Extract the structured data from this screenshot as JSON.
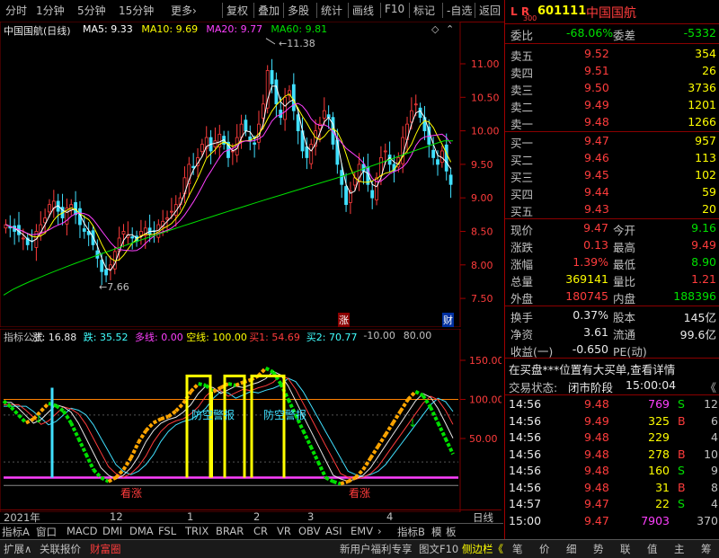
{
  "toolbar": {
    "period_items": [
      "分时",
      "1分钟",
      "5分钟",
      "15分钟",
      "更多›"
    ],
    "action_items": [
      "复权",
      "叠加",
      "多股",
      "统计",
      "画线",
      "F10",
      "标记",
      "-自选",
      "返回"
    ]
  },
  "main_chart": {
    "title": "中国国航(日线)",
    "ma_labels": [
      {
        "text": "MA5: 9.33",
        "color": "#ffffff"
      },
      {
        "text": "MA10: 9.69",
        "color": "#ffff00"
      },
      {
        "text": "MA20: 9.77",
        "color": "#ff40ff"
      },
      {
        "text": "MA60: 9.81",
        "color": "#00e000"
      }
    ],
    "price_axis": [
      "11.00",
      "10.50",
      "10.00",
      "9.50",
      "9.00",
      "8.50",
      "8.00",
      "7.50"
    ],
    "high_label": "11.38",
    "low_label": "7.66",
    "badge_zhang": "涨",
    "badge_cai": "财"
  },
  "indicator": {
    "header": [
      {
        "text": "指标公式",
        "color": "#c0c0c0"
      },
      {
        "text": "涨: 16.88",
        "color": "#e8e8e8"
      },
      {
        "text": "跌: 35.52",
        "color": "#40ffff"
      },
      {
        "text": "多线: 0.00",
        "color": "#ff40ff"
      },
      {
        "text": "空线: 100.00",
        "color": "#ffff00"
      },
      {
        "text": "买1: 54.69",
        "color": "#ff3c3c"
      },
      {
        "text": "买2: 70.77",
        "color": "#40ffff"
      },
      {
        "text": "-10.00",
        "color": "#c0c0c0"
      },
      {
        "text": "80.00",
        "color": "#c0c0c0"
      }
    ],
    "axis": [
      "150.00",
      "100.00",
      "50.00"
    ],
    "annotations": {
      "fangkong": "防空警报",
      "kanzhang_left": "看涨",
      "kanzhang_right": "看涨"
    }
  },
  "date_axis": {
    "labels": [
      "2021年",
      "12",
      "1",
      "2",
      "3",
      "4"
    ],
    "right_label": "日线"
  },
  "tabs": {
    "items": [
      "指标A",
      "窗口",
      "MACD",
      "DMI",
      "DMA",
      "FSL",
      "TRIX",
      "BRAR",
      "CR",
      "VR",
      "OBV",
      "ASI",
      "EMV",
      "›",
      "指标B",
      "模",
      "板"
    ]
  },
  "bottom_bar": {
    "left": [
      "扩展∧",
      "关联报价",
      "财富圈"
    ],
    "middle": [
      "新用户福利专享",
      "图文F10",
      "侧边栏《"
    ],
    "right": [
      "笔",
      "价",
      "细",
      "势",
      "联",
      "值",
      "主",
      "筹"
    ]
  },
  "quote": {
    "code": "601111",
    "name": "中国国航",
    "l_r_label": "L R",
    "market_label": "300",
    "weibi_label": "委比",
    "weibi_value": "-68.06%",
    "weicha_label": "委差",
    "weicha_value": "-5332",
    "sells": [
      {
        "label": "卖五",
        "price": "9.52",
        "vol": "354"
      },
      {
        "label": "卖四",
        "price": "9.51",
        "vol": "26"
      },
      {
        "label": "卖三",
        "price": "9.50",
        "vol": "3736"
      },
      {
        "label": "卖二",
        "price": "9.49",
        "vol": "1201"
      },
      {
        "label": "卖一",
        "price": "9.48",
        "vol": "1266"
      }
    ],
    "buys": [
      {
        "label": "买一",
        "price": "9.47",
        "vol": "957"
      },
      {
        "label": "买二",
        "price": "9.46",
        "vol": "113"
      },
      {
        "label": "买三",
        "price": "9.45",
        "vol": "102"
      },
      {
        "label": "买四",
        "price": "9.44",
        "vol": "59"
      },
      {
        "label": "买五",
        "price": "9.43",
        "vol": "20"
      }
    ],
    "stats": [
      {
        "l1": "现价",
        "v1": "9.47",
        "c1": "#ff3c3c",
        "l2": "今开",
        "v2": "9.16",
        "c2": "#00e000"
      },
      {
        "l1": "涨跌",
        "v1": "0.13",
        "c1": "#ff3c3c",
        "l2": "最高",
        "v2": "9.49",
        "c2": "#ff3c3c"
      },
      {
        "l1": "涨幅",
        "v1": "1.39%",
        "c1": "#ff3c3c",
        "l2": "最低",
        "v2": "8.90",
        "c2": "#00e000"
      },
      {
        "l1": "总量",
        "v1": "369141",
        "c1": "#ffff00",
        "l2": "量比",
        "v2": "1.21",
        "c2": "#ff3c3c"
      },
      {
        "l1": "外盘",
        "v1": "180745",
        "c1": "#ff3c3c",
        "l2": "内盘",
        "v2": "188396",
        "c2": "#00e000"
      }
    ],
    "stats2": [
      {
        "l1": "换手",
        "v1": "0.37%",
        "l2": "股本",
        "v2": "145亿"
      },
      {
        "l1": "净资",
        "v1": "3.61",
        "l2": "流通",
        "v2": "99.6亿"
      },
      {
        "l1": "收益(一)",
        "v1": "-0.650",
        "l2": "PE(动)",
        "v2": ""
      }
    ],
    "alert": "在买盘***位置有大买单,查看详情",
    "status_label": "交易状态:",
    "status_value": "闭市阶段",
    "status_time": "15:00:04",
    "ticks": [
      {
        "time": "14:56",
        "price": "9.48",
        "vol": "769",
        "side": "S",
        "vc": "#ff40ff",
        "sc": "#00e000",
        "num": "12"
      },
      {
        "time": "14:56",
        "price": "9.49",
        "vol": "325",
        "side": "B",
        "vc": "#ffff00",
        "sc": "#ff3c3c",
        "num": "6"
      },
      {
        "time": "14:56",
        "price": "9.48",
        "vol": "229",
        "side": "",
        "vc": "#ffff00",
        "sc": "#c0c0c0",
        "num": "4"
      },
      {
        "time": "14:56",
        "price": "9.48",
        "vol": "278",
        "side": "B",
        "vc": "#ffff00",
        "sc": "#ff3c3c",
        "num": "10"
      },
      {
        "time": "14:56",
        "price": "9.48",
        "vol": "160",
        "side": "S",
        "vc": "#ffff00",
        "sc": "#00e000",
        "num": "9"
      },
      {
        "time": "14:56",
        "price": "9.48",
        "vol": "31",
        "side": "B",
        "vc": "#ffff00",
        "sc": "#ff3c3c",
        "num": "8"
      },
      {
        "time": "14:57",
        "price": "9.47",
        "vol": "22",
        "side": "S",
        "vc": "#ffff00",
        "sc": "#00e000",
        "num": "4"
      },
      {
        "time": "15:00",
        "price": "9.47",
        "vol": "7903",
        "side": "",
        "vc": "#ff40ff",
        "sc": "#c0c0c0",
        "num": "370"
      }
    ]
  }
}
